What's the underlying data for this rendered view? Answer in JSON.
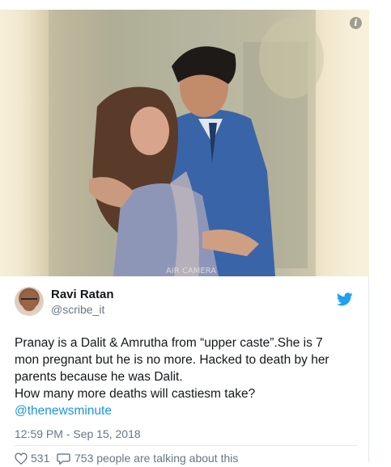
{
  "media": {
    "photo_description_icon": "info-icon",
    "info_label": "i",
    "watermark": "AIR CAMERA"
  },
  "author": {
    "name": "Ravi Ratan",
    "handle": "@scribe_it",
    "avatar_icon": "avatar",
    "platform_icon": "twitter-bird-icon"
  },
  "tweet": {
    "lines": [
      "Pranay is a Dalit & Amrutha from “upper caste”.She is 7",
      "mon pregnant but he is no more. Hacked to death by her",
      "parents because he was Dalit.",
      "How many more deaths will castiesm take?"
    ],
    "mention": "@thenewsminute",
    "timestamp": "12:59 PM - Sep 15, 2018"
  },
  "actions": {
    "like_icon": "heart-icon",
    "like_count": "531",
    "reply_icon": "speech-bubble-icon",
    "talking_text": "753 people are talking about this"
  },
  "colors": {
    "link": "#1b95e0",
    "secondary_text": "#657786",
    "twitter_blue": "#1da1f2"
  }
}
